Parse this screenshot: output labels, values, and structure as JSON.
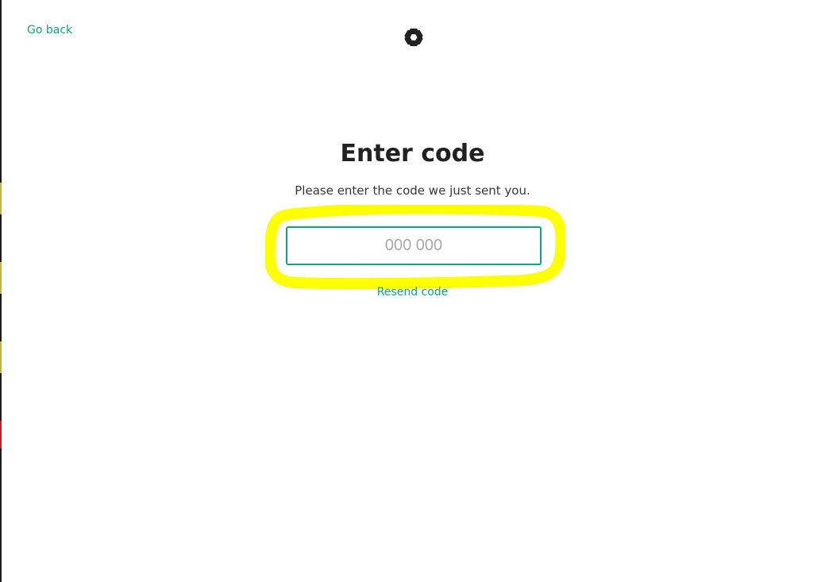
{
  "nav": {
    "go_back_label": "Go back"
  },
  "header": {
    "logo_icon": "openai-logo-icon"
  },
  "main": {
    "title": "Enter code",
    "subtitle": "Please enter the code we just sent you.",
    "code_input": {
      "placeholder": "000 000",
      "value": ""
    },
    "resend_label": "Resend code"
  },
  "colors": {
    "accent": "#10a37f",
    "highlight": "#ffff00",
    "text": "#202123",
    "subtext": "#353740",
    "placeholder": "#a8a8b3"
  }
}
